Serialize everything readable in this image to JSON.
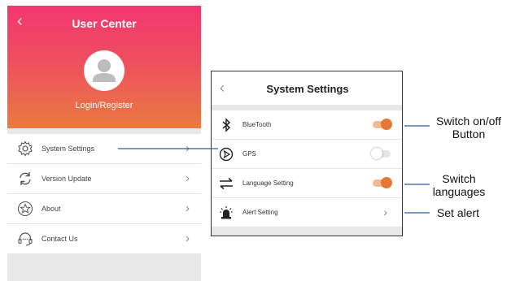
{
  "left_screen": {
    "header": {
      "back_icon": "chevron-left-icon",
      "title": "User Center",
      "login_label": "Login/Register"
    },
    "menu": [
      {
        "icon": "gear-icon",
        "label": "System Settings"
      },
      {
        "icon": "refresh-icon",
        "label": "Version Update"
      },
      {
        "icon": "star-icon",
        "label": "About"
      },
      {
        "icon": "headset-icon",
        "label": "Contact Us"
      }
    ],
    "colors": {
      "gradient_top": "#f2366f",
      "gradient_bottom": "#e97a40"
    }
  },
  "right_screen": {
    "header": {
      "back_icon": "chevron-left-icon",
      "title": "System Settings"
    },
    "rows": [
      {
        "icon": "bluetooth-icon",
        "label": "BlueTooth",
        "control": "toggle",
        "state": "on"
      },
      {
        "icon": "gps-icon",
        "label": "GPS",
        "control": "toggle",
        "state": "off"
      },
      {
        "icon": "swap-arrows-icon",
        "label": "Language Setting",
        "control": "toggle",
        "state": "on"
      },
      {
        "icon": "alarm-icon",
        "label": "Alert Setting",
        "control": "chevron"
      }
    ],
    "colors": {
      "accent": "#e47638"
    }
  },
  "annotations": {
    "switch_onoff_line1": "Switch on/off",
    "switch_onoff_line2": "Button",
    "switch_lang_line1": "Switch",
    "switch_lang_line2": "languages",
    "set_alert": "Set alert"
  }
}
